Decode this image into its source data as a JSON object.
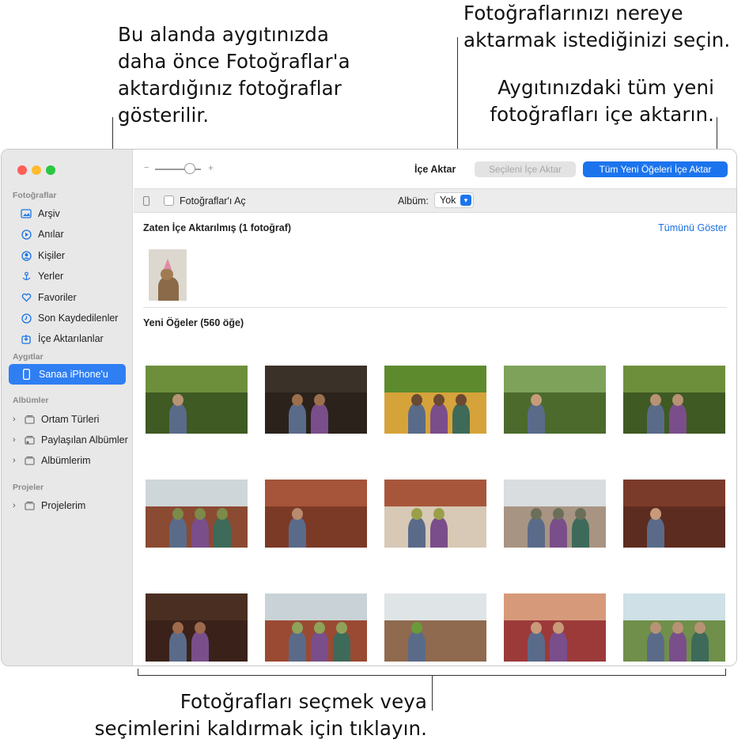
{
  "callouts": {
    "device_photos": [
      "Bu alanda aygıtınızda",
      "daha önce Fotoğraflar'a",
      "aktardığınız fotoğraflar",
      "gösterilir."
    ],
    "destination": [
      "Fotoğraflarınızı nereye",
      "aktarmak istediğinizi seçin."
    ],
    "import_all": [
      "Aygıtınızdaki tüm yeni",
      "fotoğrafları içe aktarın."
    ],
    "select": [
      "Fotoğrafları seçmek veya",
      "seçimlerini kaldırmak için tıklayın."
    ]
  },
  "sidebar": {
    "section_photos": "Fotoğraflar",
    "items": [
      {
        "label": "Arşiv",
        "icon": "photo-library-icon"
      },
      {
        "label": "Anılar",
        "icon": "memories-icon"
      },
      {
        "label": "Kişiler",
        "icon": "people-icon"
      },
      {
        "label": "Yerler",
        "icon": "places-icon"
      },
      {
        "label": "Favoriler",
        "icon": "heart-icon"
      },
      {
        "label": "Son Kaydedilenler",
        "icon": "clock-icon"
      },
      {
        "label": "İçe Aktarılanlar",
        "icon": "import-icon"
      }
    ],
    "section_devices": "Aygıtlar",
    "device": "Sanaa iPhone'u",
    "section_albums": "Albümler",
    "albums": [
      "Ortam Türleri",
      "Paylaşılan Albümler",
      "Albümlerim"
    ],
    "section_projects": "Projeler",
    "projects": [
      "Projelerim"
    ]
  },
  "toolbar": {
    "title": "İçe Aktar",
    "import_selected": "Seçileni İçe Aktar",
    "import_all": "Tüm Yeni Öğeleri İçe Aktar"
  },
  "subbar": {
    "open_photos": "Fotoğraflar'ı Aç",
    "album_label": "Albüm:",
    "album_value": "Yok"
  },
  "content": {
    "already_imported": "Zaten İçe Aktarılmış (1 fotoğraf)",
    "show_all": "Tümünü Göster",
    "new_items": "Yeni Öğeler (560 öğe)"
  },
  "colors": {
    "accent": "#1b74ee",
    "sidebar_selected": "#2f7ff3"
  }
}
